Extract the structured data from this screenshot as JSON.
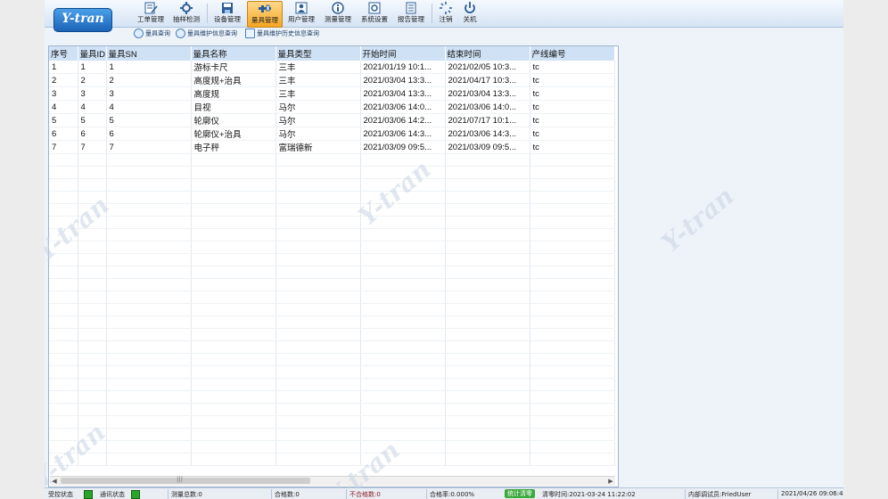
{
  "toolbar": {
    "logo": "Y-tran",
    "buttons": [
      {
        "label": "工单管理"
      },
      {
        "label": "抽样检测"
      },
      {
        "label": "设备管理"
      },
      {
        "label": "量具管理"
      },
      {
        "label": "用户管理"
      },
      {
        "label": "测量管理"
      },
      {
        "label": "系统设置"
      },
      {
        "label": "报告管理"
      },
      {
        "label": "注销"
      },
      {
        "label": "关机"
      }
    ],
    "active": "量具管理"
  },
  "subtoolbar": [
    {
      "label": "量具查询"
    },
    {
      "label": "量具维护信息查询"
    },
    {
      "label": "量具维护历史信息查询"
    }
  ],
  "table": {
    "columns": [
      "序号",
      "量具ID",
      "量具SN",
      "量具名称",
      "量具类型",
      "开始时间",
      "结束时间",
      "产线编号"
    ],
    "rows": [
      [
        "1",
        "1",
        "1",
        "游标卡尺",
        "三丰",
        "2021/01/19 10:1...",
        "2021/02/05 10:3...",
        "tc"
      ],
      [
        "2",
        "2",
        "2",
        "高度规+治具",
        "三丰",
        "2021/03/04 13:3...",
        "2021/04/17 10:3...",
        "tc"
      ],
      [
        "3",
        "3",
        "3",
        "高度规",
        "三丰",
        "2021/03/04 13:3...",
        "2021/03/04 13:3...",
        "tc"
      ],
      [
        "4",
        "4",
        "4",
        "目视",
        "马尔",
        "2021/03/06 14:0...",
        "2021/03/06 14:0...",
        "tc"
      ],
      [
        "5",
        "5",
        "5",
        "轮廓仪",
        "马尔",
        "2021/03/06 14:2...",
        "2021/07/17 10:1...",
        "tc"
      ],
      [
        "6",
        "6",
        "6",
        "轮廓仪+治具",
        "马尔",
        "2021/03/06 14:3...",
        "2021/03/06 14:3...",
        "tc"
      ],
      [
        "7",
        "7",
        "7",
        "电子秤",
        "富瑞德新",
        "2021/03/09 09:5...",
        "2021/03/09 09:5...",
        "tc"
      ]
    ],
    "scroll_thumb": "|||"
  },
  "status": {
    "control_label": "受控状态",
    "comm_label": "通讯状态",
    "total": "测量总数:0",
    "pass": "合格数:0",
    "fail": "不合格数:0",
    "rate": "合格率:0.000%",
    "clear_button": "统计清零",
    "clear_time": "清零时间:2021-03-24 11:22:02",
    "user": "内部调试员:FriedUser",
    "datetime": "2021/04/26 09:06:49"
  },
  "watermark": "Y-tran"
}
